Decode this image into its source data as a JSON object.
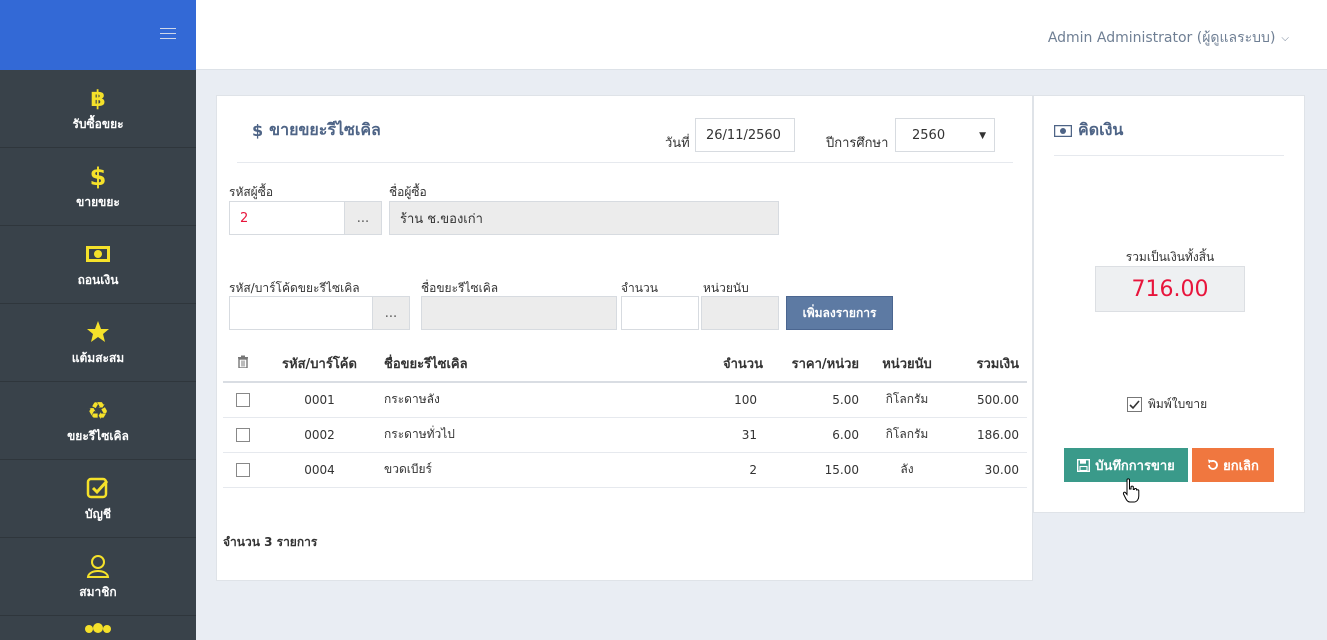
{
  "header": {
    "user": "Admin Administrator (ผู้ดูแลระบบ)"
  },
  "sidebar": {
    "items": [
      {
        "label": "รับซื้อขยะ",
        "icon": "bitcoin-icon"
      },
      {
        "label": "ขายขยะ",
        "icon": "dollar-icon"
      },
      {
        "label": "ถอนเงิน",
        "icon": "money-icon"
      },
      {
        "label": "แต้มสะสม",
        "icon": "star-icon"
      },
      {
        "label": "ขยะรีไซเคิล",
        "icon": "recycle-icon"
      },
      {
        "label": "บัญชี",
        "icon": "check-square-icon"
      },
      {
        "label": "สมาชิก",
        "icon": "user-icon"
      }
    ]
  },
  "main": {
    "title": "ขายขยะรีไซเคิล",
    "date_label": "วันที่",
    "date_value": "26/11/2560",
    "year_label": "ปีการศึกษา",
    "year_value": "2560",
    "buyer_code_label": "รหัสผู้ซื้อ",
    "buyer_code_value": "2",
    "buyer_name_label": "ชื่อผู้ซื้อ",
    "buyer_name_value": "ร้าน ช.ของเก่า",
    "dots": "...",
    "item_code_label": "รหัส/บาร์โค้ดขยะรีไซเคิล",
    "item_name_label": "ชื่อขยะรีไซเคิล",
    "qty_label": "จำนวน",
    "unit_label": "หน่วยนับ",
    "add_button": "เพิ่มลงรายการ",
    "table": {
      "headers": [
        "รหัส/บาร์โค้ด",
        "ชื่อขยะรีไซเคิล",
        "จำนวน",
        "ราคา/หน่วย",
        "หน่วยนับ",
        "รวมเงิน"
      ],
      "rows": [
        {
          "code": "0001",
          "name": "กระดาษลัง",
          "qty": "100",
          "price": "5.00",
          "unit": "กิโลกรัม",
          "total": "500.00"
        },
        {
          "code": "0002",
          "name": "กระดาษทั่วไป",
          "qty": "31",
          "price": "6.00",
          "unit": "กิโลกรัม",
          "total": "186.00"
        },
        {
          "code": "0004",
          "name": "ขวดเบียร์",
          "qty": "2",
          "price": "15.00",
          "unit": "ลัง",
          "total": "30.00"
        }
      ]
    },
    "count_text": "จำนวน 3 รายการ"
  },
  "checkout": {
    "title": "คิดเงิน",
    "total_label": "รวมเป็นเงินทั้งสิ้น",
    "total_value": "716.00",
    "print_label": "พิมพ์ใบขาย",
    "save_button": "บันทึกการขาย",
    "cancel_button": "ยกเลิก"
  },
  "colors": {
    "sidebar": "#39424a",
    "brand": "#3369d6",
    "icon_yellow": "#f5e12a",
    "save": "#3a9a8a",
    "cancel": "#f0773f",
    "total": "#e8153c"
  }
}
